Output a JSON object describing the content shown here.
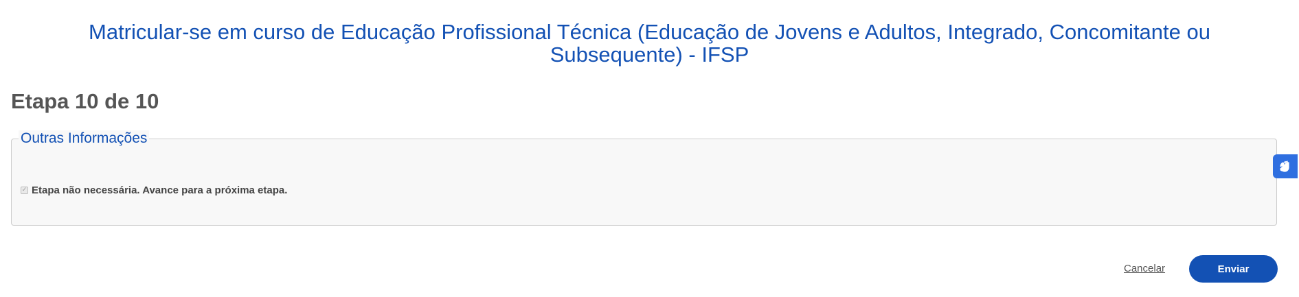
{
  "header": {
    "title": "Matricular-se em curso de Educação Profissional Técnica (Educação de Jovens e Adultos, Integrado, Concomitante ou Subsequente) - IFSP"
  },
  "step": {
    "title": "Etapa 10 de 10"
  },
  "section": {
    "legend": "Outras Informações",
    "checkbox_label": "Etapa não necessária. Avance para a próxima etapa.",
    "checkbox_checked": true
  },
  "actions": {
    "cancel_label": "Cancelar",
    "send_label": "Enviar"
  },
  "accessibility": {
    "icon": "sign-language-icon"
  },
  "colors": {
    "primary": "#1351b4",
    "heading_gray": "#555555",
    "panel_bg": "#f8f8f8",
    "vlibras_blue": "#2f6fe0"
  }
}
